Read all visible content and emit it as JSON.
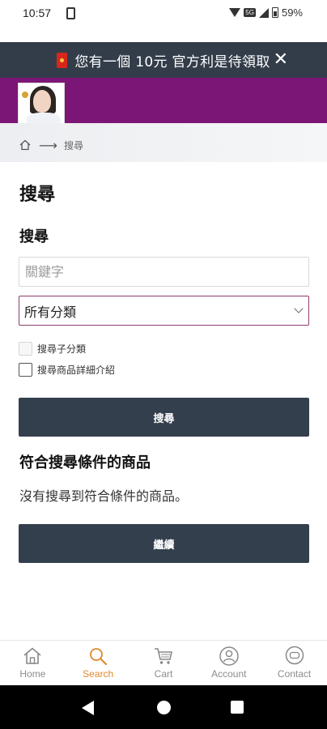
{
  "status_bar": {
    "time": "10:57",
    "battery": "59%",
    "network": "5G"
  },
  "promo": {
    "text": "您有一個 10元 官方利是待領取",
    "close_glyph": "✕",
    "icon": "red-packet-icon"
  },
  "breadcrumb": {
    "home_icon": "home-icon",
    "arrow": "⟶",
    "current": "搜尋"
  },
  "page": {
    "title": "搜尋",
    "criteria_title": "搜尋"
  },
  "search": {
    "keyword_placeholder": "關鍵字",
    "keyword_value": "",
    "category_selected": "所有分類",
    "subcategory_label": "搜尋子分類",
    "description_label": "搜尋商品詳細介紹",
    "submit_label": "搜尋"
  },
  "results": {
    "title": "符合搜尋條件的商品",
    "empty_message": "沒有搜尋到符合條件的商品。",
    "continue_label": "繼續"
  },
  "bottom_nav": {
    "items": [
      {
        "label": "Home",
        "icon": "home-icon",
        "active": false
      },
      {
        "label": "Search",
        "icon": "search-icon",
        "active": true
      },
      {
        "label": "Cart",
        "icon": "cart-icon",
        "active": false
      },
      {
        "label": "Account",
        "icon": "account-icon",
        "active": false
      },
      {
        "label": "Contact",
        "icon": "chat-icon",
        "active": false
      }
    ]
  },
  "colors": {
    "promo_bg": "#333d4a",
    "brand": "#7c1676",
    "button": "#343f4d",
    "active_nav": "#e08a2e",
    "select_border": "#8e3a6c"
  }
}
